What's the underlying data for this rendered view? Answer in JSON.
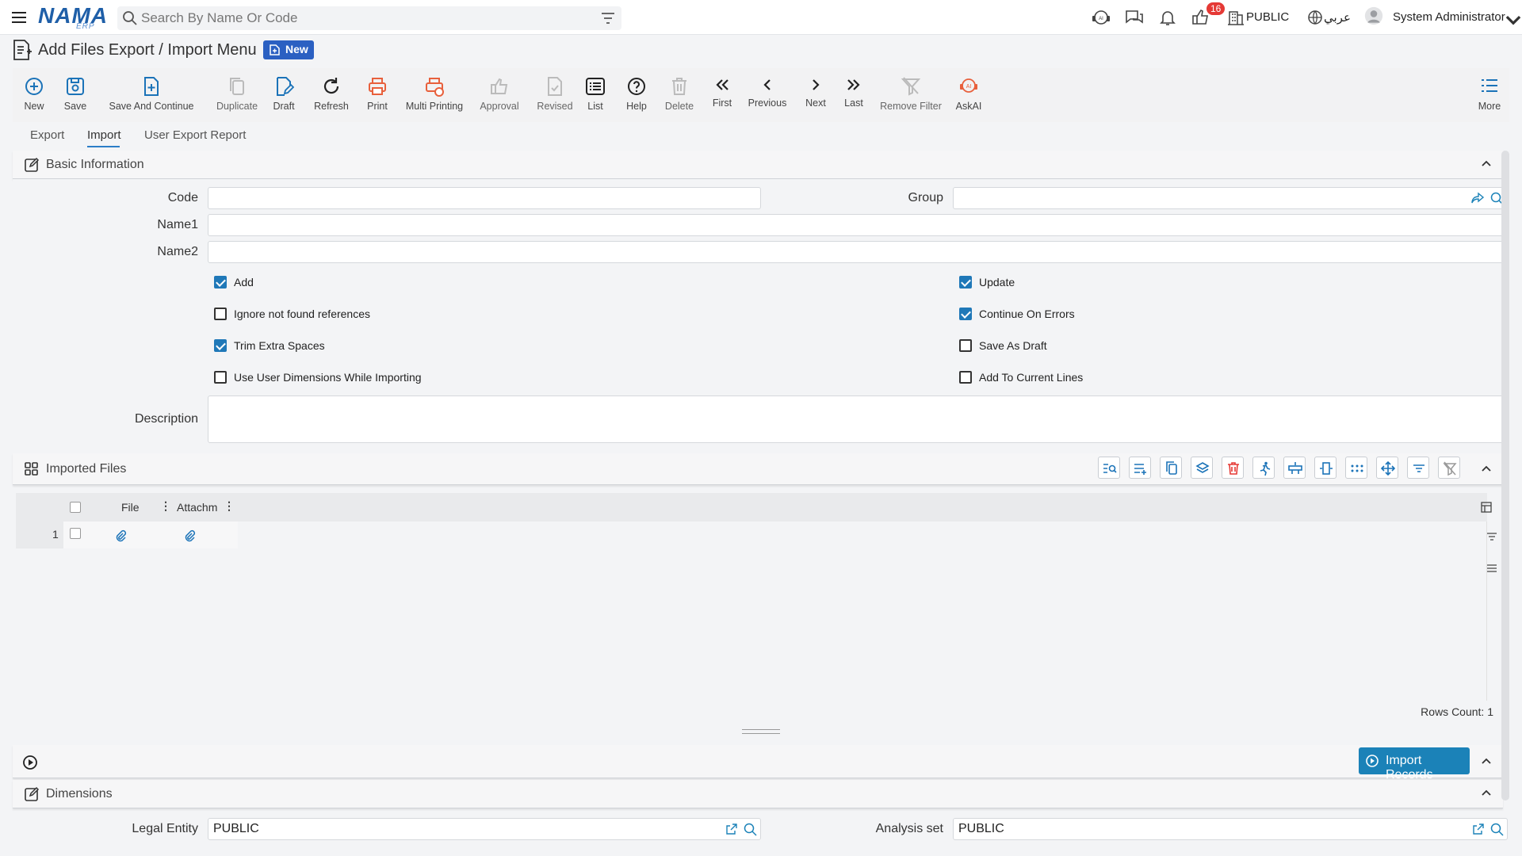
{
  "topbar": {
    "search_placeholder": "Search By Name Or Code",
    "notification_count": "16",
    "legal_entity": "PUBLIC",
    "language": "عربي",
    "user_name": "System Administrator"
  },
  "page": {
    "title": "Add Files Export / Import Menu",
    "status_badge": "New"
  },
  "toolbar": {
    "new": "New",
    "save": "Save",
    "save_and_continue": "Save And Continue",
    "duplicate": "Duplicate",
    "draft": "Draft",
    "refresh": "Refresh",
    "print": "Print",
    "multi_printing": "Multi Printing",
    "approval": "Approval",
    "revised": "Revised",
    "list": "List",
    "help": "Help",
    "delete": "Delete",
    "first": "First",
    "previous": "Previous",
    "next": "Next",
    "last": "Last",
    "remove_filter": "Remove Filter",
    "askai": "AskAI",
    "more": "More"
  },
  "tabs": [
    "Export",
    "Import",
    "User Export Report"
  ],
  "basic_info": {
    "title": "Basic Information",
    "code_label": "Code",
    "code_value": "",
    "group_label": "Group",
    "group_value": "",
    "name1_label": "Name1",
    "name1_value": "",
    "name2_label": "Name2",
    "name2_value": "",
    "description_label": "Description",
    "description_value": "",
    "checkboxes": {
      "add": {
        "label": "Add",
        "checked": true
      },
      "update": {
        "label": "Update",
        "checked": true
      },
      "ignore_not_found": {
        "label": "Ignore not found references",
        "checked": false
      },
      "continue_on_errors": {
        "label": "Continue On Errors",
        "checked": true
      },
      "trim_extra_spaces": {
        "label": "Trim Extra Spaces",
        "checked": true
      },
      "save_as_draft": {
        "label": "Save As Draft",
        "checked": false
      },
      "use_user_dimensions": {
        "label": "Use User Dimensions While Importing",
        "checked": false
      },
      "add_to_current_lines": {
        "label": "Add To Current Lines",
        "checked": false
      }
    }
  },
  "imported_files": {
    "title": "Imported Files",
    "columns": [
      "File",
      "Attachm"
    ],
    "rows": [
      {
        "num": "1"
      }
    ],
    "rows_count": "Rows Count: 1"
  },
  "actions": {
    "import_records": "Import Records"
  },
  "dimensions": {
    "title": "Dimensions",
    "legal_entity_label": "Legal Entity",
    "legal_entity_value": "PUBLIC",
    "analysis_set_label": "Analysis set",
    "analysis_set_value": "PUBLIC"
  },
  "colors": {
    "accent": "#1b82b8",
    "brand": "#1f5fa8",
    "print_orange": "#e8603c",
    "danger": "#e53935"
  }
}
